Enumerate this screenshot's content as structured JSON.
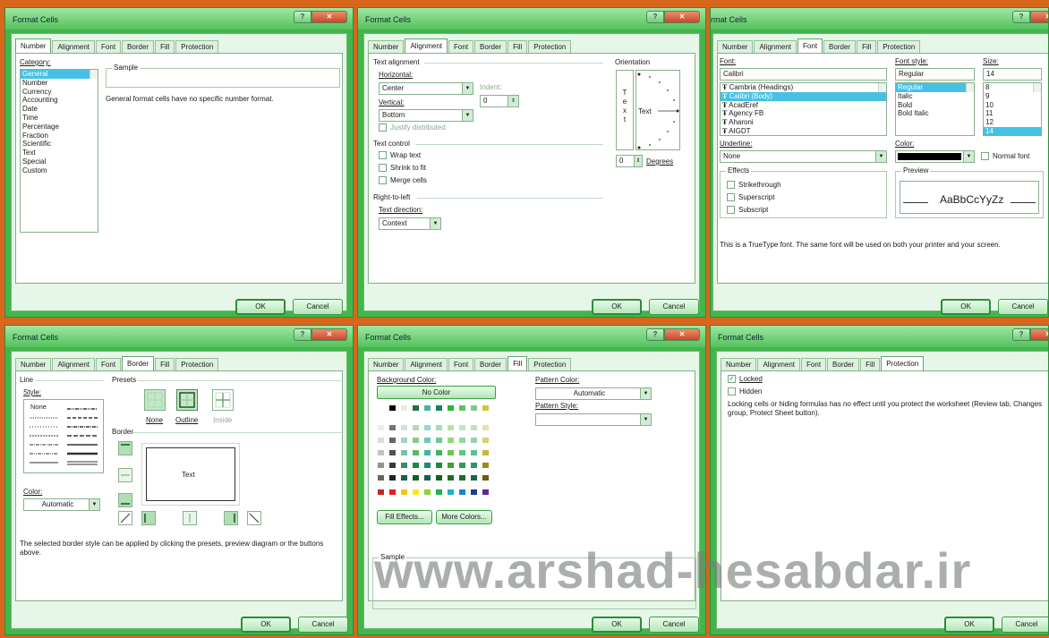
{
  "dialog_title": "Format Cells",
  "title_clipped": "rmat Cells",
  "tabs": [
    "Number",
    "Alignment",
    "Font",
    "Border",
    "Fill",
    "Protection"
  ],
  "ok": "OK",
  "cancel": "Cancel",
  "number": {
    "category_label": "Category:",
    "categories": [
      "General",
      "Number",
      "Currency",
      "Accounting",
      "Date",
      "Time",
      "Percentage",
      "Fraction",
      "Scientific",
      "Text",
      "Special",
      "Custom"
    ],
    "sample_label": "Sample",
    "description": "General format cells have no specific number format."
  },
  "alignment": {
    "text_alignment": "Text alignment",
    "horizontal_label": "Horizontal:",
    "horizontal_value": "Center",
    "indent_label": "Indent:",
    "indent_value": "0",
    "vertical_label": "Vertical:",
    "vertical_value": "Bottom",
    "justify": "Justify distributed",
    "text_control": "Text control",
    "wrap": "Wrap text",
    "shrink": "Shrink to fit",
    "merge": "Merge cells",
    "rtl": "Right-to-left",
    "direction_label": "Text direction:",
    "direction_value": "Context",
    "orientation": "Orientation",
    "vertical_text": [
      "T",
      "e",
      "x",
      "t"
    ],
    "dial_text": "Text",
    "degrees_value": "0",
    "degrees_label": "Degrees"
  },
  "font": {
    "font_label": "Font:",
    "font_value": "Calibri",
    "fonts": [
      "Cambria (Headings)",
      "Calibri (Body)",
      "AcadEref",
      "Agency FB",
      "Aharoni",
      "AIGDT"
    ],
    "style_label": "Font style:",
    "style_value": "Regular",
    "styles": [
      "Regular",
      "Italic",
      "Bold",
      "Bold Italic"
    ],
    "size_label": "Size:",
    "size_value": "14",
    "sizes": [
      "8",
      "9",
      "10",
      "11",
      "12",
      "14"
    ],
    "underline_label": "Underline:",
    "underline_value": "None",
    "color_label": "Color:",
    "normal_font": "Normal font",
    "effects": "Effects",
    "strike": "Strikethrough",
    "super": "Superscript",
    "sub": "Subscript",
    "preview": "Preview",
    "preview_text": "AaBbCcYyZz",
    "note": "This is a TrueType font.  The same font will be used on both your printer and your screen."
  },
  "border": {
    "line": "Line",
    "style_label": "Style:",
    "none_style": "None",
    "color_label": "Color:",
    "color_value": "Automatic",
    "presets": "Presets",
    "preset_none": "None",
    "preset_outline": "Outline",
    "preset_inside": "Inside",
    "border_label": "Border",
    "preview_text": "Text",
    "note": "The selected border style can be applied by clicking the presets, preview diagram or the buttons above."
  },
  "fill": {
    "bg_label": "Background Color:",
    "no_color": "No Color",
    "fill_effects": "Fill Effects...",
    "more_colors": "More Colors...",
    "pattern_color_label": "Pattern Color:",
    "pattern_color_value": "Automatic",
    "pattern_style_label": "Pattern Style:",
    "sample_label": "Sample",
    "rows": [
      [
        "#ffffff",
        "#000000",
        "#e3f1e4",
        "#2a6a40",
        "#4ab3a8",
        "#1b7f5e",
        "#2eb43a",
        "#5ec25c",
        "#83c98a",
        "#d9c23a"
      ],
      [
        "#e8f0e6",
        "#6d7a6d",
        "#c8e8de",
        "#b9d9b1",
        "#9ad8c8",
        "#a5dcb8",
        "#b6e2a4",
        "#c0e6c6",
        "#bde1cb",
        "#e8e2a6"
      ],
      [
        "#d9dfd8",
        "#5f6a5d",
        "#a2d4c4",
        "#8bc88a",
        "#6fc9b6",
        "#6fc98c",
        "#95d77c",
        "#95d7a0",
        "#93d2ae",
        "#d8cf70"
      ],
      [
        "#bcc6ba",
        "#4a564a",
        "#79c1a6",
        "#5ab95c",
        "#3fb79d",
        "#41b45f",
        "#6ec64f",
        "#62c578",
        "#5bbf90",
        "#c8b43b"
      ],
      [
        "#8d978b",
        "#333d33",
        "#2f8f6a",
        "#1f8a39",
        "#1e8a73",
        "#1d8c3a",
        "#3fa12d",
        "#2e9c4a",
        "#2a9569",
        "#9c8a1f"
      ],
      [
        "#5f685d",
        "#1e261e",
        "#1d5f48",
        "#13602a",
        "#155f50",
        "#145f28",
        "#256b1c",
        "#1f6a33",
        "#1c6549",
        "#6b5d13"
      ]
    ],
    "standard": [
      "#c0291e",
      "#e0221b",
      "#f4c414",
      "#f7e81c",
      "#8fd13c",
      "#23b14d",
      "#20b3c5",
      "#1a86c8",
      "#1d3f8c",
      "#5c2d8c"
    ]
  },
  "protection": {
    "locked": "Locked",
    "hidden": "Hidden",
    "note": "Locking cells or hiding formulas has no effect until you protect the worksheet (Review tab, Changes group, Protect Sheet button)."
  },
  "watermark": "www.arshad-hesabdar.ir"
}
